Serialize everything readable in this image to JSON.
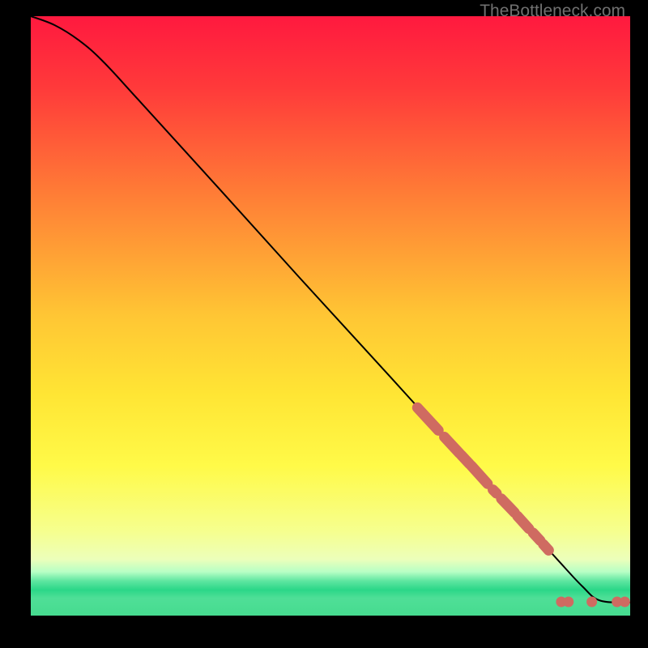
{
  "watermark": "TheBottleneck.com",
  "chart_data": {
    "type": "line",
    "title": "",
    "xlabel": "",
    "ylabel": "",
    "xlim": [
      0,
      100
    ],
    "ylim": [
      0,
      100
    ],
    "gradient_stops": [
      {
        "offset": 0.0,
        "color": "#ff193f"
      },
      {
        "offset": 0.12,
        "color": "#ff3a3a"
      },
      {
        "offset": 0.3,
        "color": "#ff7e36"
      },
      {
        "offset": 0.5,
        "color": "#ffc634"
      },
      {
        "offset": 0.63,
        "color": "#ffe534"
      },
      {
        "offset": 0.75,
        "color": "#fffa48"
      },
      {
        "offset": 0.86,
        "color": "#f6ff8f"
      },
      {
        "offset": 0.906,
        "color": "#ecffba"
      },
      {
        "offset": 0.927,
        "color": "#b7ffc5"
      },
      {
        "offset": 0.942,
        "color": "#5fe6a1"
      },
      {
        "offset": 0.957,
        "color": "#2bd788"
      },
      {
        "offset": 0.971,
        "color": "#4fdf97"
      },
      {
        "offset": 1.0,
        "color": "#46db8f"
      }
    ],
    "curve": {
      "x": [
        0,
        4,
        8,
        12,
        18,
        30,
        45,
        60,
        70,
        78,
        84,
        88,
        92,
        95,
        100
      ],
      "y": [
        100,
        98.5,
        96,
        92.5,
        86,
        72.8,
        56.2,
        39.8,
        28.8,
        20.1,
        13.6,
        9.2,
        4.9,
        2.5,
        2.2
      ]
    },
    "highlighted_segments": [
      {
        "x0": 64.5,
        "y0": 34.7,
        "x1": 68.0,
        "y1": 30.9
      },
      {
        "x0": 69.0,
        "y0": 29.8,
        "x1": 71.5,
        "y1": 27.1
      },
      {
        "x0": 71.8,
        "y0": 26.8,
        "x1": 73.2,
        "y1": 25.3
      },
      {
        "x0": 73.5,
        "y0": 25.0,
        "x1": 76.2,
        "y1": 22.0
      },
      {
        "x0": 77.1,
        "y0": 21.0,
        "x1": 77.7,
        "y1": 20.4
      },
      {
        "x0": 78.5,
        "y0": 19.5,
        "x1": 80.7,
        "y1": 17.2
      },
      {
        "x0": 81.2,
        "y0": 16.6,
        "x1": 83.1,
        "y1": 14.5
      },
      {
        "x0": 83.8,
        "y0": 13.8,
        "x1": 85.0,
        "y1": 12.5
      },
      {
        "x0": 85.5,
        "y0": 11.9,
        "x1": 86.4,
        "y1": 10.9
      }
    ],
    "dots": [
      {
        "x": 88.5,
        "y": 2.3
      },
      {
        "x": 89.7,
        "y": 2.3
      },
      {
        "x": 93.6,
        "y": 2.3
      },
      {
        "x": 97.8,
        "y": 2.3
      },
      {
        "x": 99.1,
        "y": 2.3
      }
    ]
  }
}
